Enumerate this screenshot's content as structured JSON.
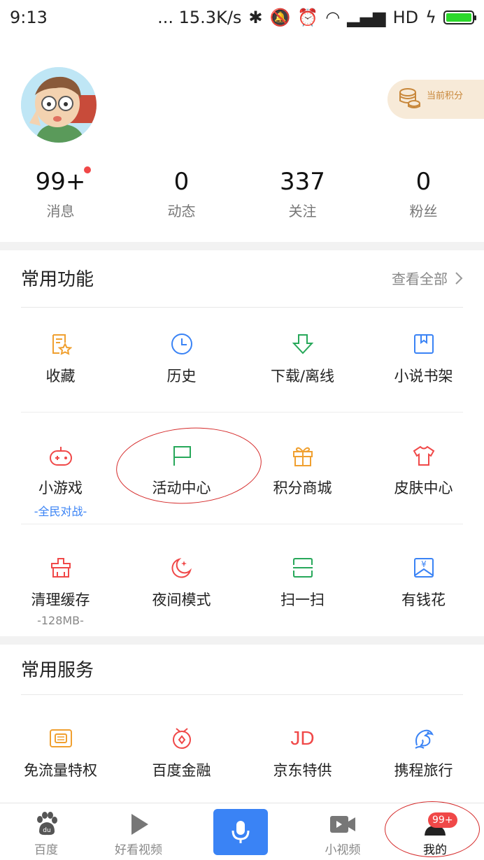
{
  "status_bar": {
    "time": "9:13",
    "speed": "... 15.3K/s",
    "network": "HD"
  },
  "profile": {
    "points_label": "当前积分"
  },
  "stats": [
    {
      "value": "99+",
      "label": "消息",
      "has_dot": true
    },
    {
      "value": "0",
      "label": "动态"
    },
    {
      "value": "337",
      "label": "关注"
    },
    {
      "value": "0",
      "label": "粉丝"
    }
  ],
  "common_functions": {
    "title": "常用功能",
    "view_all": "查看全部",
    "items": [
      {
        "label": "收藏",
        "icon": "favorite-icon",
        "color": "#f0a030"
      },
      {
        "label": "历史",
        "icon": "clock-icon",
        "color": "#3a83f5"
      },
      {
        "label": "下载/离线",
        "icon": "download-icon",
        "color": "#27a85a"
      },
      {
        "label": "小说书架",
        "icon": "bookshelf-icon",
        "color": "#3a83f5"
      },
      {
        "label": "小游戏",
        "sub": "-全民对战-",
        "icon": "gamepad-icon",
        "color": "#f04848",
        "sub_color": "#3a83f5"
      },
      {
        "label": "活动中心",
        "icon": "flag-icon",
        "color": "#27a85a"
      },
      {
        "label": "积分商城",
        "icon": "gift-icon",
        "color": "#f0a030"
      },
      {
        "label": "皮肤中心",
        "icon": "shirt-icon",
        "color": "#f04848"
      },
      {
        "label": "清理缓存",
        "sub": "-128MB-",
        "icon": "clean-icon",
        "color": "#f04848",
        "sub_color": "#888888"
      },
      {
        "label": "夜间模式",
        "icon": "moon-icon",
        "color": "#f04848"
      },
      {
        "label": "扫一扫",
        "icon": "scan-icon",
        "color": "#27a85a"
      },
      {
        "label": "有钱花",
        "icon": "money-icon",
        "color": "#3a83f5"
      }
    ]
  },
  "common_services": {
    "title": "常用服务",
    "items": [
      {
        "label": "免流量特权",
        "icon": "data-card-icon",
        "color": "#f0a030"
      },
      {
        "label": "百度金融",
        "icon": "finance-icon",
        "color": "#f04848"
      },
      {
        "label": "京东特供",
        "icon": "jd-icon",
        "icon_text": "JD",
        "color": "#f04848"
      },
      {
        "label": "携程旅行",
        "icon": "ctrip-icon",
        "color": "#3a83f5"
      }
    ]
  },
  "bottom_nav": {
    "items": [
      {
        "label": "百度",
        "icon": "paw-icon"
      },
      {
        "label": "好看视频",
        "icon": "play-icon"
      },
      {
        "label": "",
        "icon": "mic-icon"
      },
      {
        "label": "小视频",
        "icon": "video-camera-icon"
      },
      {
        "label": "我的",
        "icon": "person-icon"
      }
    ],
    "badge": "99+"
  },
  "colors": {
    "accent_blue": "#3a83f5",
    "red": "#f04848",
    "green": "#27a85a",
    "orange": "#f0a030"
  }
}
